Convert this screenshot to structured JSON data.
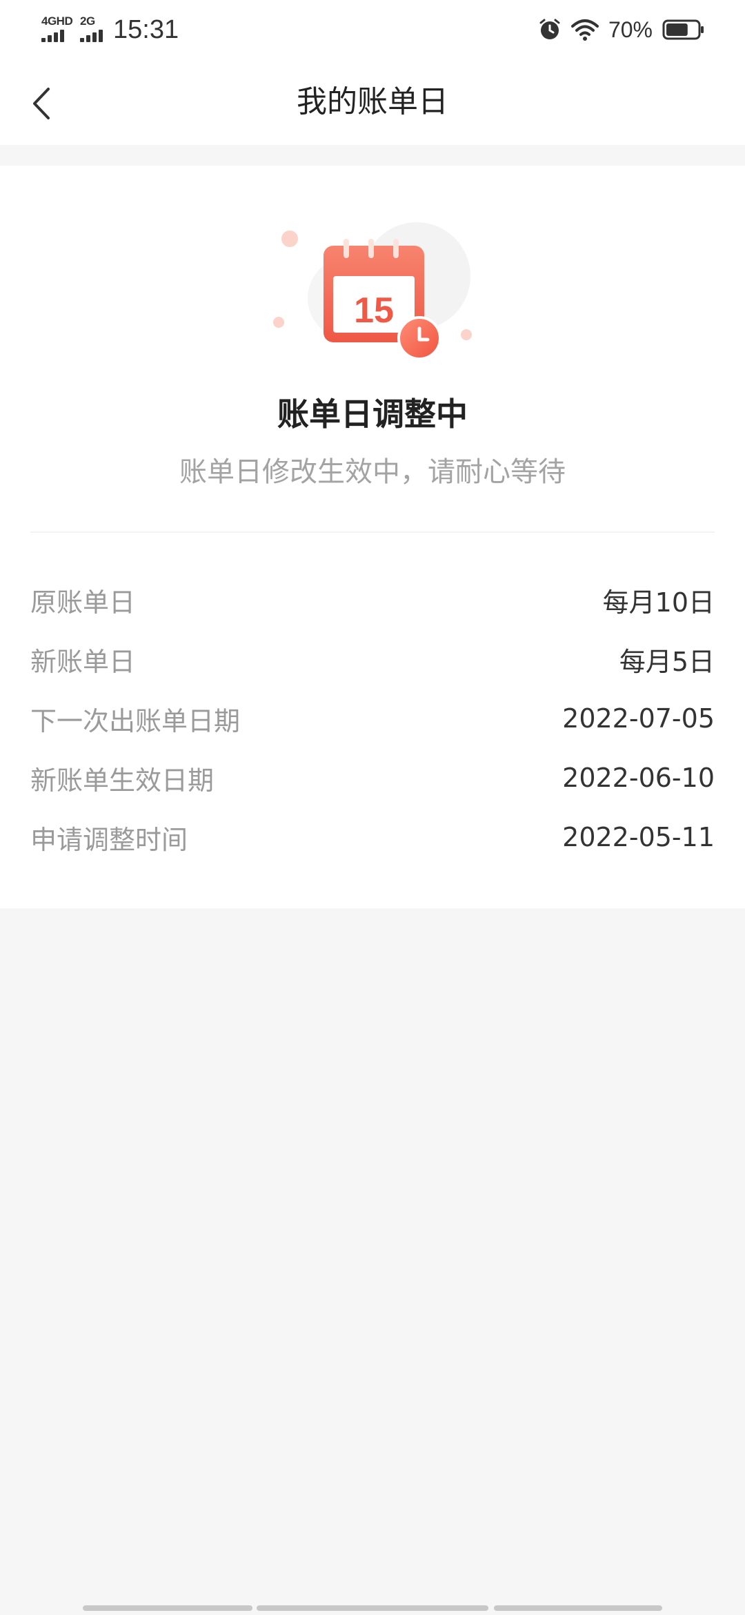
{
  "status_bar": {
    "network_1": "4GHD",
    "network_2": "2G",
    "time": "15:31",
    "icons": [
      "alarm-icon",
      "wifi-icon",
      "battery-icon"
    ],
    "battery_percent": "70%",
    "battery_level": 0.7
  },
  "nav": {
    "back_icon": "chevron-left-icon",
    "title": "我的账单日"
  },
  "status": {
    "illustration_icon": "calendar-clock-icon",
    "calendar_day": "15",
    "title": "账单日调整中",
    "subtitle": "账单日修改生效中，请耐心等待"
  },
  "details": [
    {
      "label": "原账单日",
      "value": "每月10日"
    },
    {
      "label": "新账单日",
      "value": "每月5日"
    },
    {
      "label": "下一次出账单日期",
      "value": "2022-07-05"
    },
    {
      "label": "新账单生效日期",
      "value": "2022-06-10"
    },
    {
      "label": "申请调整时间",
      "value": "2022-05-11"
    }
  ],
  "colors": {
    "accent": "#f2604b",
    "background": "#f6f6f6",
    "card": "#ffffff",
    "label_gray": "#9a9a9a"
  }
}
